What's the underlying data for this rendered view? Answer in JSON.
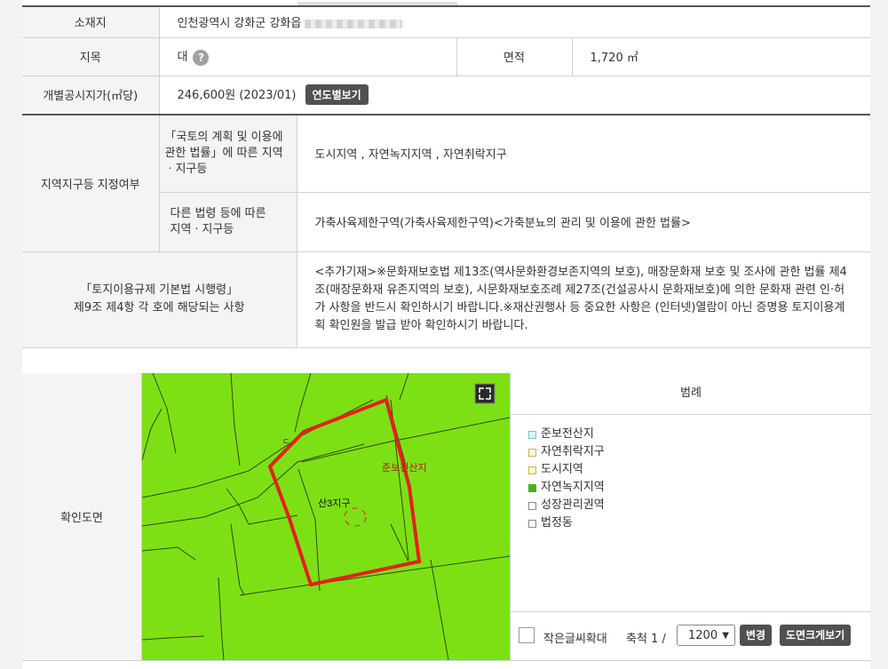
{
  "location": {
    "label": "소재지",
    "value": "인천광역시 강화군 강화읍"
  },
  "landcat": {
    "label": "지목",
    "value": "대",
    "help": "?",
    "area_label": "면적",
    "area_value": "1,720 ㎡"
  },
  "price": {
    "label": "개별공시지가(㎡당)",
    "value": "246,600원 (2023/01)",
    "button": "연도별보기"
  },
  "zoning": {
    "label": "지역지구등 지정여부",
    "law1_label": "「국토의 계획 및 이용에 관한 법률」에 따른 지역ㆍ지구등",
    "law1_value": "도시지역 , 자연녹지지역 , 자연취락지구",
    "law2_label": "다른 법령 등에 따른 지역ㆍ지구등",
    "law2_value": "가축사육제한구역(가축사육제한구역)<가축분뇨의 관리 및 이용에 관한 법률>"
  },
  "regulation": {
    "label_line1": "「토지이용규제 기본법 시행령」",
    "label_line2": "제9조 제4항 각 호에 해당되는 사항",
    "note": "<추가기재>※문화재보호법 제13조(역사문화환경보존지역의 보호), 매장문화재 보호 및 조사에 관한 법률 제4조(매장문화재 유존지역의 보호), 시문화재보호조례 제27조(건설공사시 문화재보호)에 의한 문화재 관련 인·허가 사항을 반드시 확인하시기 바랍니다.※재산권행사 등 중요한 사항은 (인터넷)열람이 아닌 증명용 토지이용계획 확인원을 발급 받아 확인하시기 바랍니다."
  },
  "map": {
    "label": "확인도면",
    "text_zone": "준보전산지",
    "text_district": "산3지구",
    "colors": {
      "fill": "#7de015",
      "parcel": "#e3211c",
      "line": "#2e4a10"
    }
  },
  "legend": {
    "title": "범례",
    "items": [
      {
        "label": "준보전산지",
        "color": "#d9f5f5",
        "border": "#6cc"
      },
      {
        "label": "자연취락지구",
        "color": "#fff9d0",
        "border": "#c9b73a"
      },
      {
        "label": "도시지역",
        "color": "#fff9d0",
        "border": "#c9b73a"
      },
      {
        "label": "자연녹지지역",
        "color": "#4caf1e",
        "border": "#4caf1e"
      },
      {
        "label": "성장관리권역",
        "color": "#fff",
        "border": "#888"
      },
      {
        "label": "법정동",
        "color": "#fff",
        "border": "#888"
      }
    ],
    "checkbox_label": "작은글씨확대",
    "scale_label": "축척 1 /",
    "scale_value": "1200",
    "change_button": "변경",
    "enlarge_button": "도면크게보기"
  }
}
